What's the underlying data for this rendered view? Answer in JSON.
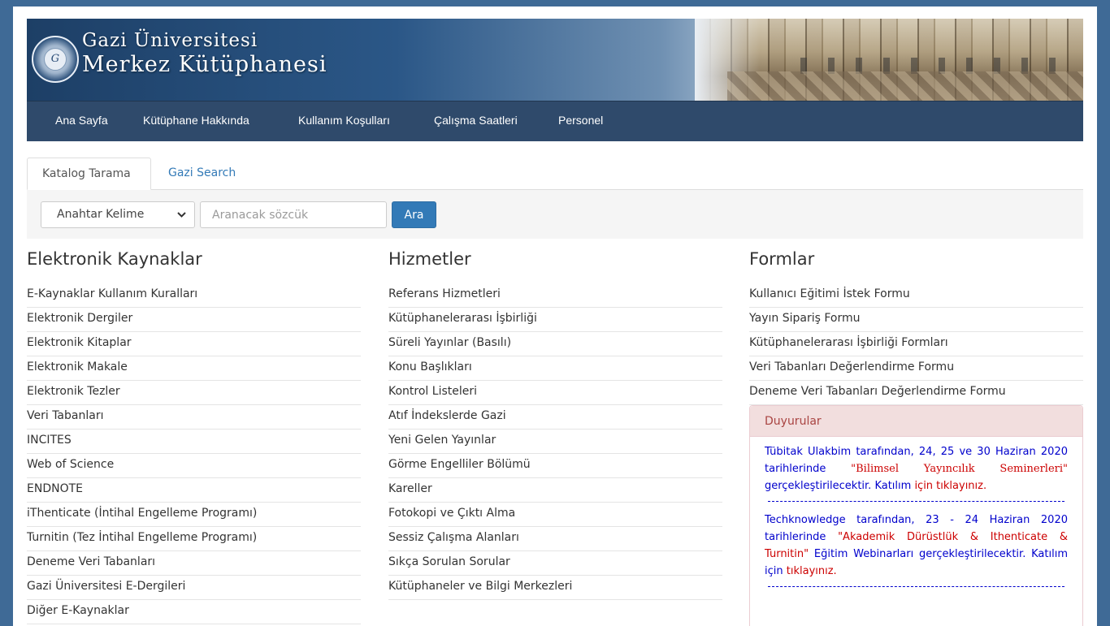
{
  "header": {
    "title_line1": "Gazi Üniversitesi",
    "title_line2": "Merkez Kütüphanesi",
    "seal_letter": "G"
  },
  "nav": {
    "items": [
      "Ana Sayfa",
      "Kütüphane Hakkında",
      "Kullanım Koşulları",
      "Çalışma Saatleri",
      "Personel"
    ]
  },
  "tabs": [
    "Katalog Tarama",
    "Gazi Search"
  ],
  "search": {
    "select_value": "Anahtar Kelime",
    "input_placeholder": "Aranacak sözcük",
    "button_label": "Ara"
  },
  "columns": {
    "electronic": {
      "title": "Elektronik Kaynaklar",
      "items": [
        "E-Kaynaklar Kullanım Kuralları",
        "Elektronik Dergiler",
        "Elektronik Kitaplar",
        "Elektronik Makale",
        "Elektronik Tezler",
        "Veri Tabanları",
        "INCITES",
        "Web of Science",
        "ENDNOTE",
        "iThenticate (İntihal Engelleme Programı)",
        "Turnitin (Tez İntihal Engelleme Programı)",
        "Deneme Veri Tabanları",
        "Gazi Üniversitesi E-Dergileri",
        "Diğer E-Kaynaklar"
      ]
    },
    "services": {
      "title": "Hizmetler",
      "items": [
        "Referans Hizmetleri",
        "Kütüphanelerarası İşbirliği",
        "Süreli Yayınlar (Basılı)",
        "Konu Başlıkları",
        "Kontrol Listeleri",
        "Atıf İndekslerde Gazi",
        "Yeni Gelen Yayınlar",
        "Görme Engelliler Bölümü",
        "Kareller",
        "Fotokopi ve Çıktı Alma",
        "Sessiz Çalışma Alanları",
        "Sıkça Sorulan Sorular",
        "Kütüphaneler ve Bilgi Merkezleri"
      ]
    },
    "forms": {
      "title": "Formlar",
      "items": [
        "Kullanıcı Eğitimi İstek Formu",
        "Yayın Sipariş Formu",
        "Kütüphanelerarası İşbirliği Formları",
        "Veri Tabanları Değerlendirme Formu",
        "Deneme Veri Tabanları Değerlendirme Formu"
      ]
    }
  },
  "announcements": {
    "heading": "Duyurular",
    "a1": {
      "pre": "Tübitak Ulakbim tarafından, 24, 25 ve 30 Haziran 2020 tarihlerinde ",
      "highlight": "\"Bilimsel Yayıncılık Seminerleri\"",
      "post": " gerçekleştirilecektir. Katılım ",
      "link": "için tıklayınız."
    },
    "separator": "----------------------------------------------------------------------",
    "a2": {
      "pre": "Techknowledge tarafından, 23 - 24 Haziran 2020 tarihlerinde ",
      "highlight_a": "\"Akademik Dürüstlük &",
      "highlight_b": "Ithenticate & Turnitin\"",
      "post": " Eğitim Webinarları gerçekleştirilecektir. Katılım için ",
      "link": "tıklayınız."
    }
  },
  "colors": {
    "background": "#3f6a96",
    "navbar": "#2f4a6b",
    "link": "#337ab7",
    "panel_heading_bg": "#f2dede",
    "panel_heading_text": "#a94442"
  }
}
